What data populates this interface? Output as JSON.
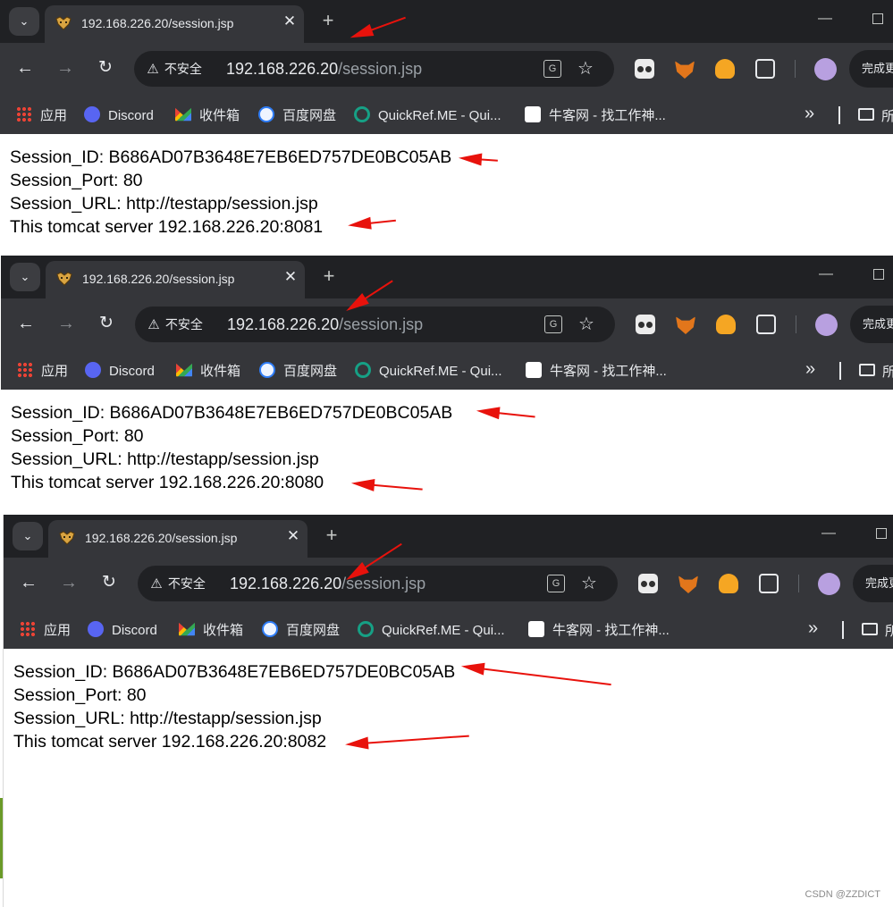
{
  "browser": {
    "tab_title": "192.168.226.20/session.jsp",
    "tab_close": "✕",
    "new_tab": "+",
    "tab_search": "⌄",
    "min_btn": "—",
    "security_label": "不安全",
    "url_host": "192.168.226.20",
    "url_path": "/session.jsp",
    "translate_icon": "G",
    "star_icon": "☆",
    "back": "←",
    "forward": "→",
    "reload": "↻",
    "finish_label": "完成更新",
    "bookmarks": [
      {
        "label": "应用",
        "icon": "apps-icon"
      },
      {
        "label": "Discord",
        "icon": "discord-icon"
      },
      {
        "label": "收件箱",
        "icon": "gmail-icon"
      },
      {
        "label": "百度网盘",
        "icon": "baidu-netdisk-icon"
      },
      {
        "label": "QuickRef.ME - Qui...",
        "icon": "quickref-icon"
      },
      {
        "label": "牛客网 - 找工作神...",
        "icon": "nowcoder-icon"
      }
    ],
    "bookmarks_more": "»",
    "folder_label": "所"
  },
  "screenshots": [
    {
      "session_id": "Session_ID: B686AD07B3648E7EB6ED757DE0BC05AB",
      "session_port": "Session_Port: 80",
      "session_url": "Session_URL: http://testapp/session.jsp",
      "server": "This tomcat server 192.168.226.20:8081"
    },
    {
      "session_id": "Session_ID: B686AD07B3648E7EB6ED757DE0BC05AB",
      "session_port": "Session_Port: 80",
      "session_url": "Session_URL: http://testapp/session.jsp",
      "server": "This tomcat server 192.168.226.20:8080"
    },
    {
      "session_id": "Session_ID: B686AD07B3648E7EB6ED757DE0BC05AB",
      "session_port": "Session_Port: 80",
      "session_url": "Session_URL: http://testapp/session.jsp",
      "server": "This tomcat server 192.168.226.20:8082"
    }
  ],
  "annotation_color": "#e8120c",
  "watermark": "CSDN @ZZDICT"
}
